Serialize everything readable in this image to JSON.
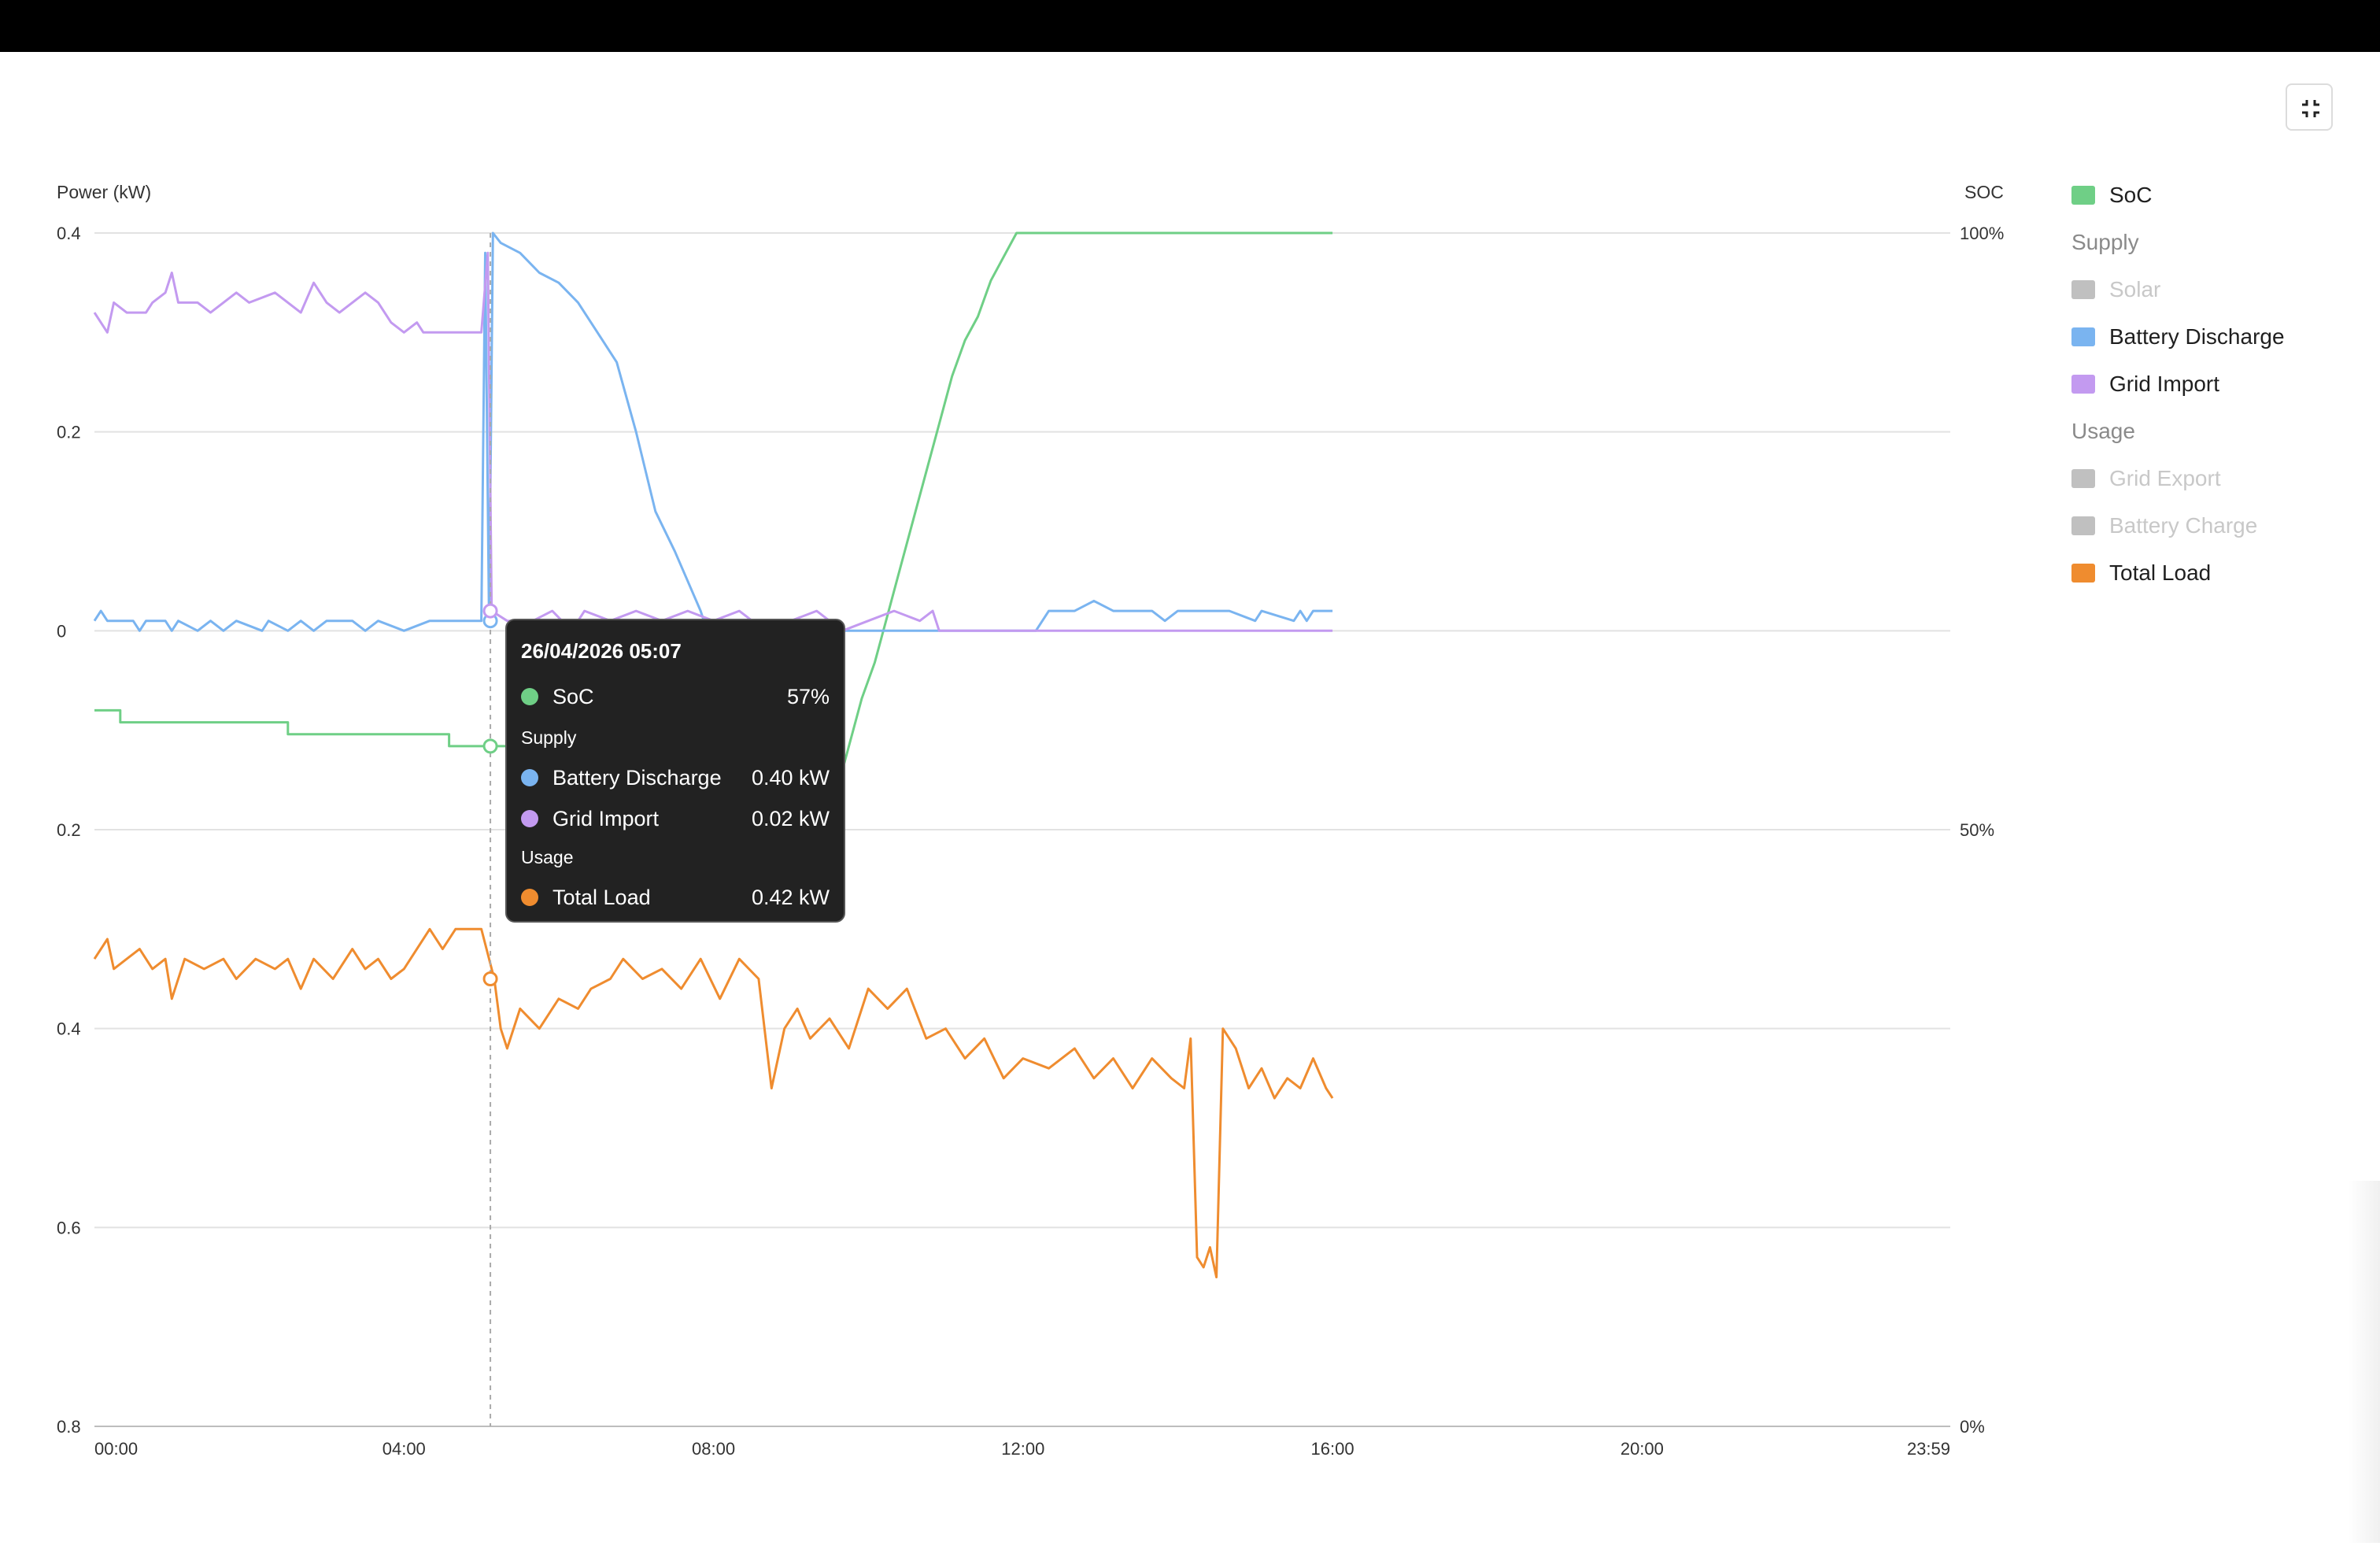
{
  "window": {
    "collapse_icon": "collapse-icon"
  },
  "chart_data": {
    "type": "line",
    "left_axis": {
      "title": "Power (kW)",
      "tick_values": [
        0.4,
        0.2,
        0,
        -0.2,
        -0.4,
        -0.6,
        -0.8
      ],
      "tick_labels": [
        "0.4",
        "0.2",
        "0",
        "0.2",
        "0.4",
        "0.6",
        "0.8"
      ],
      "range": [
        -0.8,
        0.4
      ]
    },
    "right_axis": {
      "title": "SOC",
      "tick_values": [
        100,
        50,
        0
      ],
      "tick_labels": [
        "100%",
        "50%",
        "0%"
      ],
      "range": [
        0,
        100
      ]
    },
    "x_axis": {
      "tick_values": [
        0,
        240,
        480,
        720,
        960,
        1200,
        1439
      ],
      "tick_labels": [
        "00:00",
        "04:00",
        "08:00",
        "12:00",
        "16:00",
        "20:00",
        "23:59"
      ],
      "range_minutes": [
        0,
        1439
      ]
    },
    "grid": true,
    "legend_position": "right",
    "series": [
      {
        "name": "SoC",
        "axis": "right",
        "color": "#6fcf86",
        "points": [
          [
            0,
            60
          ],
          [
            20,
            60
          ],
          [
            20,
            59
          ],
          [
            150,
            59
          ],
          [
            150,
            58
          ],
          [
            275,
            58
          ],
          [
            275,
            57
          ],
          [
            320,
            57
          ],
          [
            330,
            55
          ],
          [
            340,
            53
          ],
          [
            355,
            50
          ],
          [
            365,
            48
          ],
          [
            375,
            47
          ],
          [
            385,
            46
          ],
          [
            400,
            46
          ],
          [
            420,
            45
          ],
          [
            430,
            44
          ],
          [
            460,
            44
          ],
          [
            480,
            44
          ],
          [
            500,
            44
          ],
          [
            525,
            44
          ],
          [
            540,
            45
          ],
          [
            555,
            48
          ],
          [
            565,
            51
          ],
          [
            575,
            53
          ],
          [
            585,
            57
          ],
          [
            595,
            61
          ],
          [
            605,
            64
          ],
          [
            615,
            68
          ],
          [
            625,
            72
          ],
          [
            635,
            76
          ],
          [
            645,
            80
          ],
          [
            655,
            84
          ],
          [
            665,
            88
          ],
          [
            675,
            91
          ],
          [
            685,
            93
          ],
          [
            695,
            96
          ],
          [
            705,
            98
          ],
          [
            715,
            100
          ],
          [
            730,
            100
          ],
          [
            960,
            100
          ]
        ]
      },
      {
        "name": "Battery Discharge",
        "axis": "left",
        "color": "#7ab4f0",
        "points": [
          [
            0,
            0.01
          ],
          [
            5,
            0.02
          ],
          [
            10,
            0.01
          ],
          [
            30,
            0.01
          ],
          [
            35,
            0
          ],
          [
            40,
            0.01
          ],
          [
            55,
            0.01
          ],
          [
            60,
            0
          ],
          [
            65,
            0.01
          ],
          [
            80,
            0
          ],
          [
            90,
            0.01
          ],
          [
            100,
            0
          ],
          [
            110,
            0.01
          ],
          [
            130,
            0
          ],
          [
            135,
            0.01
          ],
          [
            150,
            0
          ],
          [
            160,
            0.01
          ],
          [
            170,
            0
          ],
          [
            180,
            0.01
          ],
          [
            200,
            0.01
          ],
          [
            210,
            0
          ],
          [
            220,
            0.01
          ],
          [
            240,
            0
          ],
          [
            260,
            0.01
          ],
          [
            280,
            0.01
          ],
          [
            295,
            0.01
          ],
          [
            300,
            0.01
          ],
          [
            303,
            0.38
          ],
          [
            306,
            0.01
          ],
          [
            309,
            0.4
          ],
          [
            315,
            0.39
          ],
          [
            330,
            0.38
          ],
          [
            345,
            0.36
          ],
          [
            360,
            0.35
          ],
          [
            375,
            0.33
          ],
          [
            390,
            0.3
          ],
          [
            405,
            0.27
          ],
          [
            420,
            0.2
          ],
          [
            435,
            0.12
          ],
          [
            450,
            0.08
          ],
          [
            460,
            0.05
          ],
          [
            470,
            0.02
          ],
          [
            475,
            0
          ],
          [
            500,
            0
          ],
          [
            520,
            0
          ],
          [
            560,
            0
          ],
          [
            600,
            0
          ],
          [
            640,
            0
          ],
          [
            700,
            0
          ],
          [
            730,
            0
          ],
          [
            740,
            0.02
          ],
          [
            760,
            0.02
          ],
          [
            775,
            0.03
          ],
          [
            790,
            0.02
          ],
          [
            820,
            0.02
          ],
          [
            830,
            0.01
          ],
          [
            840,
            0.02
          ],
          [
            880,
            0.02
          ],
          [
            900,
            0.01
          ],
          [
            905,
            0.02
          ],
          [
            930,
            0.01
          ],
          [
            935,
            0.02
          ],
          [
            940,
            0.01
          ],
          [
            945,
            0.02
          ],
          [
            960,
            0.02
          ]
        ]
      },
      {
        "name": "Grid Import",
        "axis": "left",
        "color": "#c39af0",
        "points": [
          [
            0,
            0.32
          ],
          [
            10,
            0.3
          ],
          [
            15,
            0.33
          ],
          [
            25,
            0.32
          ],
          [
            40,
            0.32
          ],
          [
            45,
            0.33
          ],
          [
            55,
            0.34
          ],
          [
            60,
            0.36
          ],
          [
            65,
            0.33
          ],
          [
            80,
            0.33
          ],
          [
            90,
            0.32
          ],
          [
            100,
            0.33
          ],
          [
            110,
            0.34
          ],
          [
            120,
            0.33
          ],
          [
            140,
            0.34
          ],
          [
            150,
            0.33
          ],
          [
            160,
            0.32
          ],
          [
            170,
            0.35
          ],
          [
            180,
            0.33
          ],
          [
            190,
            0.32
          ],
          [
            200,
            0.33
          ],
          [
            210,
            0.34
          ],
          [
            220,
            0.33
          ],
          [
            230,
            0.31
          ],
          [
            240,
            0.3
          ],
          [
            250,
            0.31
          ],
          [
            255,
            0.3
          ],
          [
            260,
            0.3
          ],
          [
            300,
            0.3
          ],
          [
            305,
            0.38
          ],
          [
            308,
            0.02
          ],
          [
            320,
            0.01
          ],
          [
            340,
            0.01
          ],
          [
            355,
            0.02
          ],
          [
            370,
            0
          ],
          [
            380,
            0.02
          ],
          [
            400,
            0.01
          ],
          [
            420,
            0.02
          ],
          [
            440,
            0.01
          ],
          [
            460,
            0.02
          ],
          [
            480,
            0.01
          ],
          [
            500,
            0.02
          ],
          [
            520,
            0
          ],
          [
            540,
            0.01
          ],
          [
            560,
            0.02
          ],
          [
            580,
            0
          ],
          [
            600,
            0.01
          ],
          [
            620,
            0.02
          ],
          [
            640,
            0.01
          ],
          [
            650,
            0.02
          ],
          [
            655,
            0
          ],
          [
            660,
            0
          ],
          [
            960,
            0
          ]
        ]
      },
      {
        "name": "Total Load",
        "axis": "left",
        "color": "#ef8c2f",
        "points": [
          [
            0,
            -0.33
          ],
          [
            10,
            -0.31
          ],
          [
            15,
            -0.34
          ],
          [
            25,
            -0.33
          ],
          [
            35,
            -0.32
          ],
          [
            45,
            -0.34
          ],
          [
            55,
            -0.33
          ],
          [
            60,
            -0.37
          ],
          [
            70,
            -0.33
          ],
          [
            85,
            -0.34
          ],
          [
            100,
            -0.33
          ],
          [
            110,
            -0.35
          ],
          [
            125,
            -0.33
          ],
          [
            140,
            -0.34
          ],
          [
            150,
            -0.33
          ],
          [
            160,
            -0.36
          ],
          [
            170,
            -0.33
          ],
          [
            185,
            -0.35
          ],
          [
            200,
            -0.32
          ],
          [
            210,
            -0.34
          ],
          [
            220,
            -0.33
          ],
          [
            230,
            -0.35
          ],
          [
            240,
            -0.34
          ],
          [
            250,
            -0.32
          ],
          [
            260,
            -0.3
          ],
          [
            270,
            -0.32
          ],
          [
            280,
            -0.3
          ],
          [
            300,
            -0.3
          ],
          [
            310,
            -0.35
          ],
          [
            315,
            -0.4
          ],
          [
            320,
            -0.42
          ],
          [
            330,
            -0.38
          ],
          [
            345,
            -0.4
          ],
          [
            360,
            -0.37
          ],
          [
            375,
            -0.38
          ],
          [
            385,
            -0.36
          ],
          [
            400,
            -0.35
          ],
          [
            410,
            -0.33
          ],
          [
            425,
            -0.35
          ],
          [
            440,
            -0.34
          ],
          [
            455,
            -0.36
          ],
          [
            470,
            -0.33
          ],
          [
            485,
            -0.37
          ],
          [
            500,
            -0.33
          ],
          [
            515,
            -0.35
          ],
          [
            525,
            -0.46
          ],
          [
            535,
            -0.4
          ],
          [
            545,
            -0.38
          ],
          [
            555,
            -0.41
          ],
          [
            570,
            -0.39
          ],
          [
            585,
            -0.42
          ],
          [
            600,
            -0.36
          ],
          [
            615,
            -0.38
          ],
          [
            630,
            -0.36
          ],
          [
            645,
            -0.41
          ],
          [
            660,
            -0.4
          ],
          [
            675,
            -0.43
          ],
          [
            690,
            -0.41
          ],
          [
            705,
            -0.45
          ],
          [
            720,
            -0.43
          ],
          [
            740,
            -0.44
          ],
          [
            760,
            -0.42
          ],
          [
            775,
            -0.45
          ],
          [
            790,
            -0.43
          ],
          [
            805,
            -0.46
          ],
          [
            820,
            -0.43
          ],
          [
            835,
            -0.45
          ],
          [
            845,
            -0.46
          ],
          [
            850,
            -0.41
          ],
          [
            855,
            -0.63
          ],
          [
            860,
            -0.64
          ],
          [
            865,
            -0.62
          ],
          [
            870,
            -0.65
          ],
          [
            875,
            -0.4
          ],
          [
            885,
            -0.42
          ],
          [
            895,
            -0.46
          ],
          [
            905,
            -0.44
          ],
          [
            915,
            -0.47
          ],
          [
            925,
            -0.45
          ],
          [
            935,
            -0.46
          ],
          [
            945,
            -0.43
          ],
          [
            955,
            -0.46
          ],
          [
            960,
            -0.47
          ]
        ]
      }
    ],
    "crosshair_minutes": 307
  },
  "legend": {
    "items": [
      {
        "label": "SoC",
        "color": "#6fcf86",
        "kind": "series",
        "muted": false
      },
      {
        "label": "Supply",
        "kind": "group"
      },
      {
        "label": "Solar",
        "color": "#c0c0c0",
        "kind": "series",
        "muted": true
      },
      {
        "label": "Battery Discharge",
        "color": "#7ab4f0",
        "kind": "series",
        "muted": false
      },
      {
        "label": "Grid Import",
        "color": "#c39af0",
        "kind": "series",
        "muted": false
      },
      {
        "label": "Usage",
        "kind": "group"
      },
      {
        "label": "Grid Export",
        "color": "#c0c0c0",
        "kind": "series",
        "muted": true
      },
      {
        "label": "Battery Charge",
        "color": "#c0c0c0",
        "kind": "series",
        "muted": true
      },
      {
        "label": "Total Load",
        "color": "#ef8c2f",
        "kind": "series",
        "muted": false
      }
    ]
  },
  "tooltip": {
    "title": "26/04/2026 05:07",
    "soc_label": "SoC",
    "soc_value": "57%",
    "supply_label": "Supply",
    "battery_label": "Battery Discharge",
    "battery_value": "0.40 kW",
    "grid_label": "Grid Import",
    "grid_value": "0.02 kW",
    "usage_label": "Usage",
    "load_label": "Total Load",
    "load_value": "0.42 kW"
  }
}
